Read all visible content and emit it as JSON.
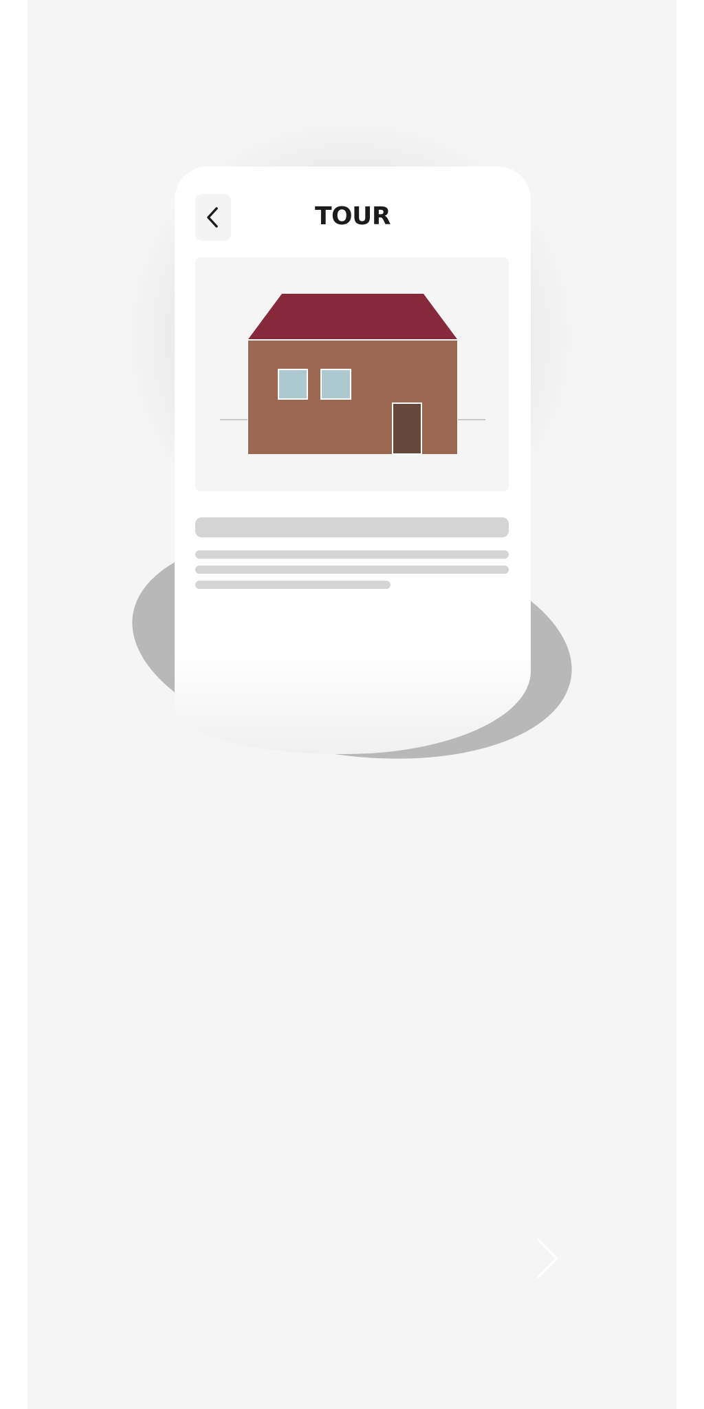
{
  "screen": {
    "title": "TOUR",
    "back_icon": "chevron-left-icon",
    "next_icon": "chevron-right-icon",
    "illustration": "house-illustration"
  },
  "colors": {
    "page_background": "#f5f5f5",
    "card_background": "#ffffff",
    "roof": "#862a3b",
    "wall": "#9a6750",
    "window": "#aec8d0",
    "door": "#664739",
    "placeholder": "#d4d4d4",
    "shadow_blob": "#b8b8b8"
  }
}
